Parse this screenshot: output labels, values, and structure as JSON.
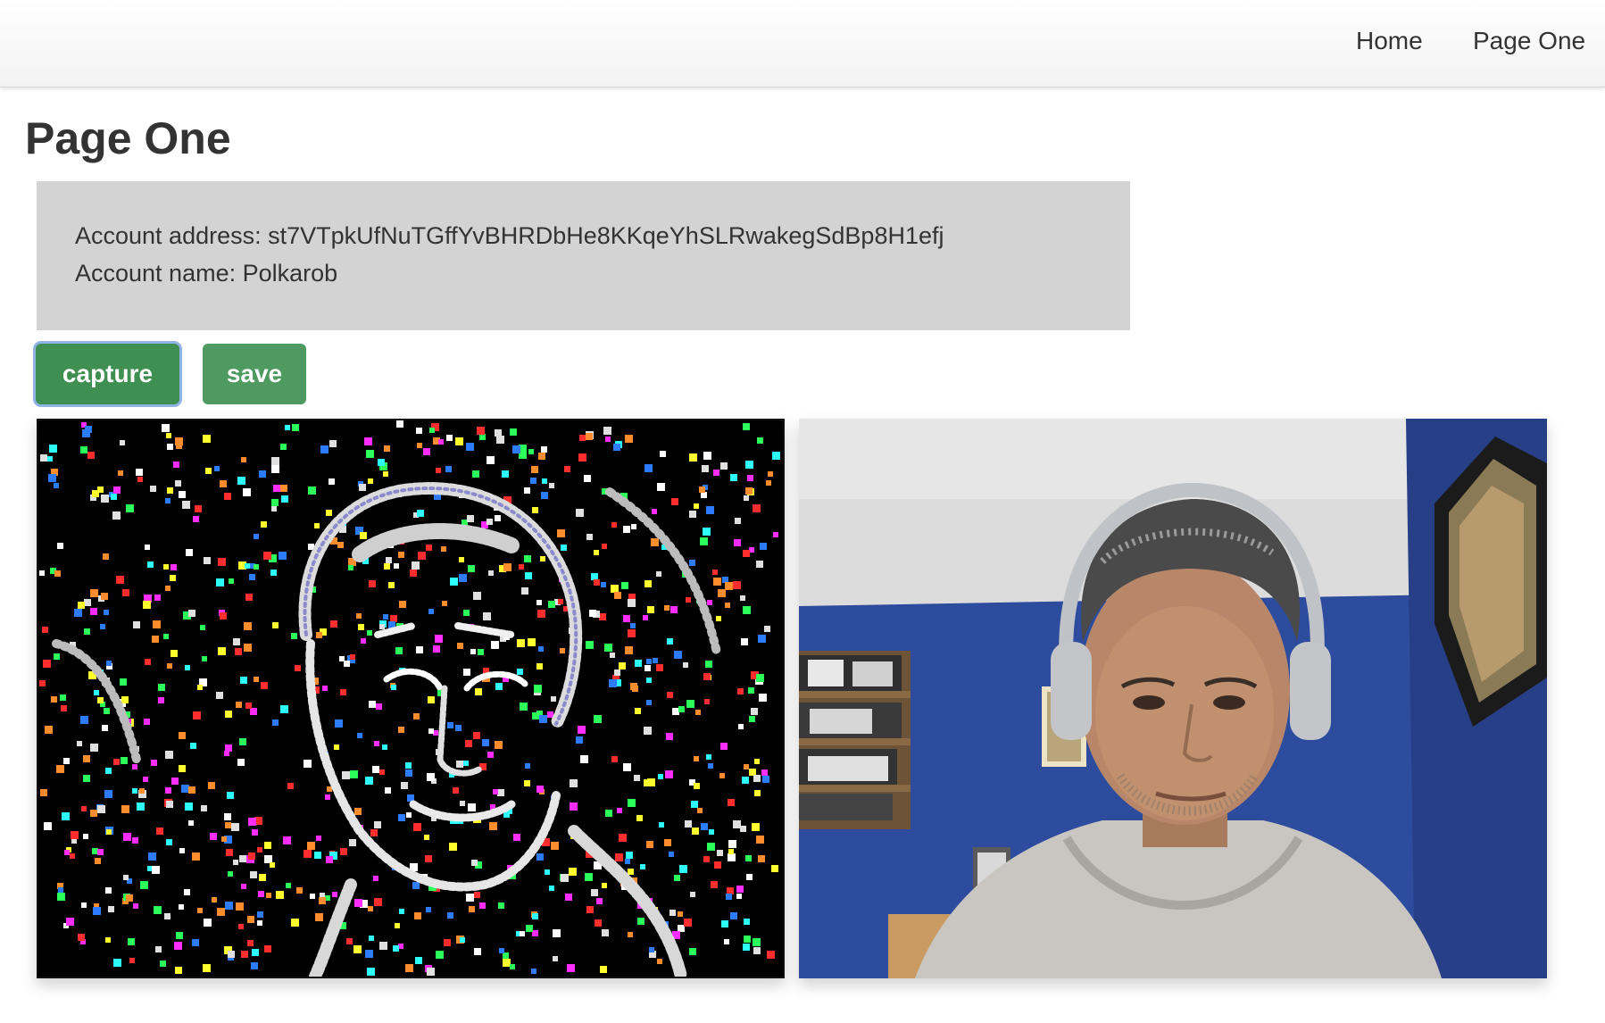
{
  "nav": {
    "home_label": "Home",
    "page_one_label": "Page One"
  },
  "page": {
    "title": "Page One"
  },
  "account": {
    "address_line": "Account address: st7VTpkUfNuTGffYvBHRDbHe8KKqeYhSLRwakegSdBp8H1efj",
    "name_line": "Account name: Polkarob"
  },
  "buttons": {
    "capture_label": "capture",
    "save_label": "save"
  },
  "colors": {
    "button_green": "#4e9a60",
    "panel_gray": "#d3d3d3",
    "wall_blue": "#2c4a9a"
  },
  "images": {
    "processed": "edge-filtered-webcam-image",
    "live": "webcam-video-feed"
  }
}
